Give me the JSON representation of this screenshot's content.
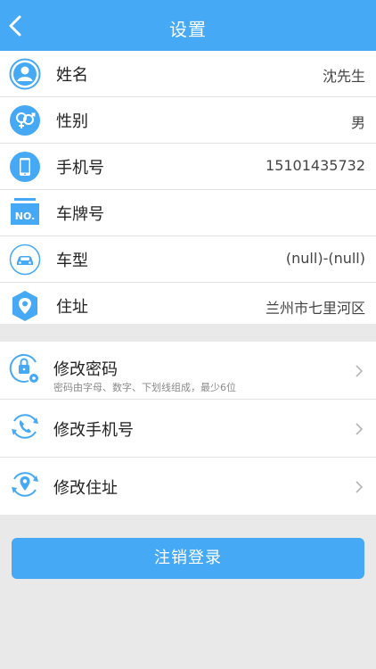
{
  "header": {
    "title": "设置",
    "back_icon": "chevron-left-icon"
  },
  "profile": [
    {
      "key": "name",
      "label": "姓名",
      "value": "沈先生",
      "icon": "user-icon"
    },
    {
      "key": "gender",
      "label": "性别",
      "value": "男",
      "icon": "gender-icon"
    },
    {
      "key": "phone",
      "label": "手机号",
      "value": "15101435732",
      "icon": "phone-icon"
    },
    {
      "key": "plate",
      "label": "车牌号",
      "value": "",
      "icon": "license-plate-icon",
      "icon_text": "NO."
    },
    {
      "key": "car_model",
      "label": "车型",
      "value": "(null)-(null)",
      "icon": "car-icon"
    },
    {
      "key": "address",
      "label": "住址",
      "value": "兰州市七里河区",
      "icon": "location-icon"
    }
  ],
  "actions": [
    {
      "key": "change_password",
      "label": "修改密码",
      "hint": "密码由字母、数字、下划线组成，最少6位",
      "icon": "lock-settings-icon"
    },
    {
      "key": "change_phone",
      "label": "修改手机号",
      "icon": "phone-refresh-icon"
    },
    {
      "key": "change_address",
      "label": "修改住址",
      "icon": "location-refresh-icon"
    }
  ],
  "logout_label": "注销登录",
  "colors": {
    "accent": "#45a9f5",
    "background": "#e9e9e9"
  }
}
